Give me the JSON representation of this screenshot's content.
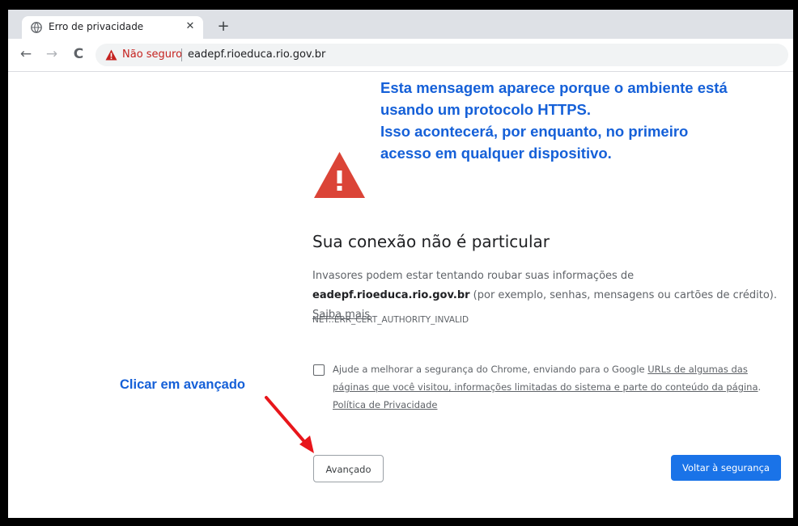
{
  "tab": {
    "title": "Erro de privacidade",
    "favicon": "globe-icon",
    "close_glyph": "✕",
    "new_tab_glyph": "+"
  },
  "toolbar": {
    "back_glyph": "←",
    "forward_glyph": "→",
    "reload_glyph": "C",
    "security_label": "Não seguro",
    "url": "eadepf.rioeduca.rio.gov.br"
  },
  "annotations": {
    "top_lines": [
      "Esta mensagem aparece porque o ambiente está",
      "usando um protocolo HTTPS.",
      "Isso acontecerá, por enquanto, no primeiro",
      "acesso em qualquer dispositivo."
    ],
    "click_hint": "Clicar em avançado",
    "color": "#1560d8",
    "arrow_color": "#e8161b"
  },
  "interstitial": {
    "heading": "Sua conexão não é particular",
    "desc_prefix": "Invasores podem estar tentando roubar suas informações de ",
    "desc_domain": "eadepf.rioeduca.rio.gov.br",
    "desc_suffix": " (por exemplo, senhas, mensagens ou cartões de crédito). ",
    "learn_more": "Saiba mais",
    "error_code": "NET::ERR_CERT_AUTHORITY_INVALID",
    "optin_prefix": "Ajude a melhorar a segurança do Chrome, enviando para o Google ",
    "optin_link": "URLs de algumas das páginas que você visitou, informações limitadas do sistema e parte do conteúdo da página",
    "optin_sep": ". ",
    "privacy_link": "Política de Privacidade",
    "advanced_button": "Avançado",
    "back_button": "Voltar à segurança",
    "error_icon": "warning-triangle-icon",
    "icon_color": "#db4437",
    "primary_color": "#1a73e8"
  }
}
